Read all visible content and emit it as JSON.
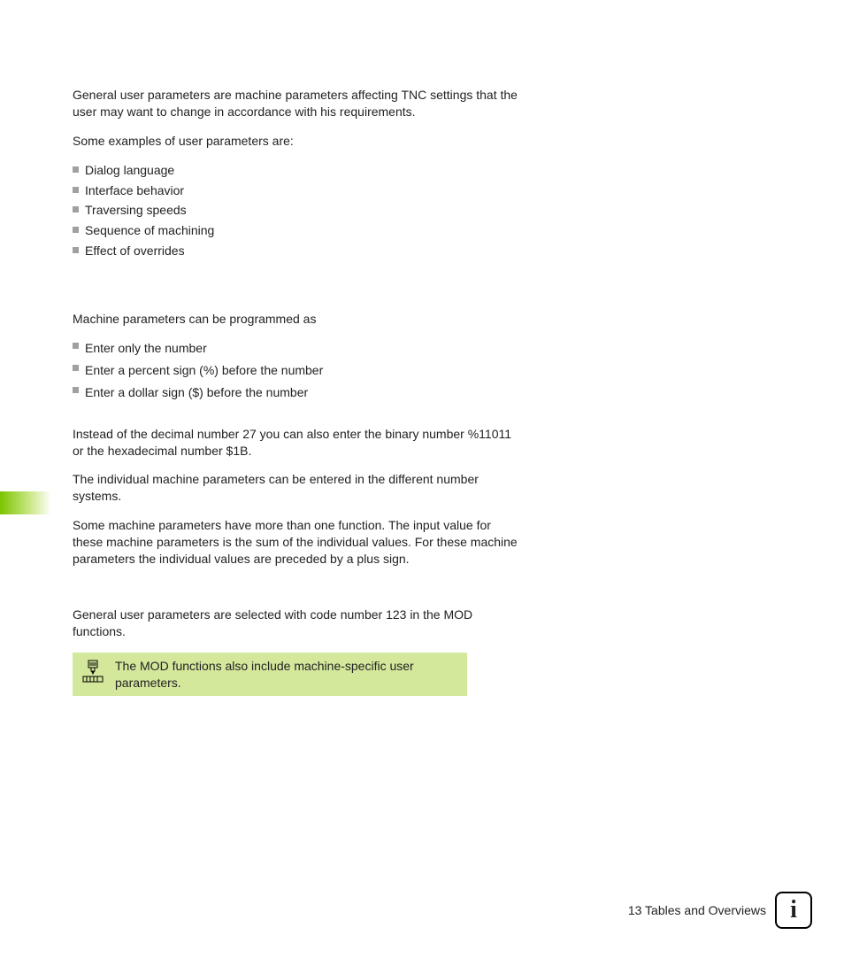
{
  "intro": "General user parameters are machine parameters affecting TNC settings that the user may want to change in accordance with his requirements.",
  "examples_lead": "Some examples of user parameters are:",
  "examples": [
    "Dialog language",
    "Interface behavior",
    "Traversing speeds",
    "Sequence of machining",
    "Effect of overrides"
  ],
  "prog_lead": "Machine parameters can be programmed as",
  "prog_items": [
    "Enter only the number",
    "Enter a percent sign (%) before the number",
    "Enter a dollar sign ($) before the number"
  ],
  "para_decimal": "Instead of the decimal number 27 you can also enter the binary number %11011 or the hexadecimal number $1B.",
  "para_individual": "The individual machine parameters can be entered in the different number systems.",
  "para_multi": "Some machine parameters have more than one function. The input value for these machine parameters is the sum of the individual values. For these machine parameters the individual values are preceded by a plus sign.",
  "select_text": "General user parameters are selected with code number 123 in the MOD functions.",
  "note_text": "The MOD functions also include machine-specific user parameters.",
  "footer": {
    "chapter_num": "13",
    "chapter_title": "Tables and Overviews",
    "info_glyph": "i"
  }
}
